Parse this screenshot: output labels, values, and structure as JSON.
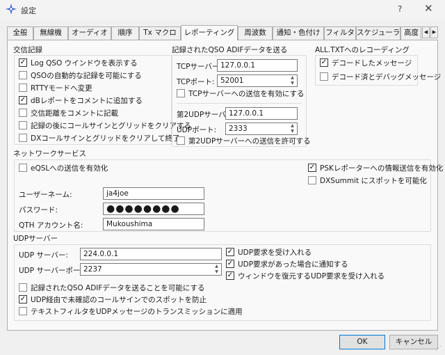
{
  "window": {
    "title": "設定",
    "help": "?",
    "close": "✕"
  },
  "tabs": [
    "全般",
    "無線機",
    "オーディオ",
    "順序",
    "Tx マクロ",
    "レポーティング",
    "周波数",
    "通知・色付け",
    "フィルタ",
    "スケジューラ",
    "高度"
  ],
  "tab_scroll": {
    "left": "◀",
    "right": "▶"
  },
  "logging": {
    "title": "交信記録",
    "items": [
      {
        "label": "Log QSO ウインドウを表示する",
        "checked": true
      },
      {
        "label": "QSOの自動的な記録を可能にする",
        "checked": false
      },
      {
        "label": "RTTYモードへ変更",
        "checked": false
      },
      {
        "label": "dBレポートをコメントに追加する",
        "checked": true
      },
      {
        "label": "交信距離をコメントに記載",
        "checked": false
      },
      {
        "label": "記録の後にコールサインとグリッドをクリアする",
        "checked": false
      },
      {
        "label": "DXコールサインとグリッドをクリアして終了",
        "checked": false
      }
    ]
  },
  "adif": {
    "title": "記録されたQSO ADIFデータを送る",
    "tcp_server_label": "TCPサーバー:",
    "tcp_server": "127.0.0.1",
    "tcp_port_label": "TCPポート:",
    "tcp_port": "52001",
    "tcp_enable": "TCPサーバーへの送信を有効にする",
    "udp2_server_label": "第2UDPサーバー",
    "udp2_server": "127.0.0.1",
    "udp2_port_label": "UDPポート:",
    "udp2_port": "2333",
    "udp2_enable": "第2UDPサーバーへの送信を許可する"
  },
  "alltxt": {
    "title": "ALL.TXTへのレコーディング",
    "items": [
      {
        "label": "デコードしたメッセージ",
        "checked": true
      },
      {
        "label": "デコード済とデバッグメッセージ",
        "checked": false
      }
    ]
  },
  "network": {
    "title": "ネットワークサービス",
    "eqsl": "eQSLへの送信を有効化",
    "psk": "PSKレポーターへの情報送信を有効化",
    "dxsummit": "DXSummit にスポットを可能化",
    "username_label": "ユーザーネーム:",
    "username": "ja4joe",
    "password_label": "パスワード:",
    "password": "●●●●●●●●",
    "qth_label": "QTH アカウント名:",
    "qth": "Mukoushima"
  },
  "udp": {
    "title": "UDPサーバー",
    "server_label": "UDP サーバー:",
    "server": "224.0.0.1",
    "port_label": "UDP サーバーポート:",
    "port": "2237",
    "accept": "UDP要求を受け入れる",
    "notify": "UDP要求があった場合に通知する",
    "restore": "ウィンドウを復元するUDP要求を受け入れる",
    "adif_send": "記録されたQSO ADIFデータを送ることを可能にする",
    "prevent": "UDP経由で未確認のコールサインでのスポットを防止",
    "filter": "テキストフィルタをUDPメッセージのトランスミッションに適用"
  },
  "buttons": {
    "ok": "OK",
    "cancel": "キャンセル"
  },
  "check_glyph": "✓"
}
